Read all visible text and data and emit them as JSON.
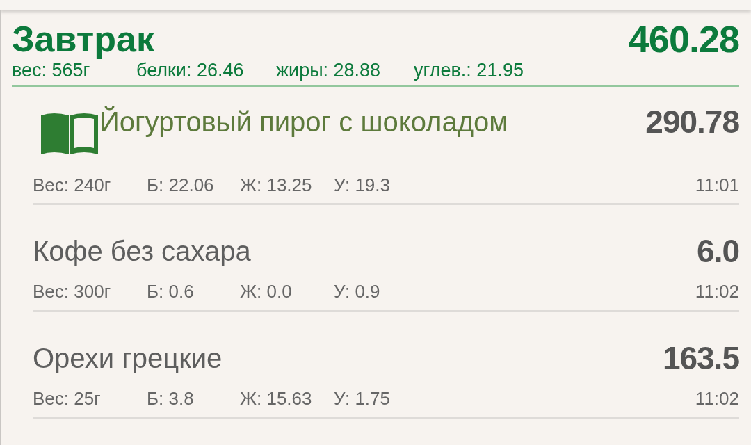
{
  "meal": {
    "title": "Завтрак",
    "calories": "460.28",
    "totals": [
      "вес: 565г",
      "белки: 26.46",
      "жиры: 28.88",
      "углев.: 21.95"
    ]
  },
  "items": [
    {
      "kind": "recipe",
      "name": "Йогуртовый пирог с шоколадом",
      "calories": "290.78",
      "details": [
        "Вес: 240г",
        "Б: 22.06",
        "Ж: 13.25",
        "У: 19.3"
      ],
      "time": "11:01"
    },
    {
      "kind": "product",
      "name": "Кофе без сахара",
      "calories": "6.0",
      "details": [
        "Вес: 300г",
        "Б: 0.6",
        "Ж: 0.0",
        "У: 0.9"
      ],
      "time": "11:02"
    },
    {
      "kind": "product",
      "name": "Орехи грецкие",
      "calories": "163.5",
      "details": [
        "Вес: 25г",
        "Б: 3.8",
        "Ж: 15.63",
        "У: 1.75"
      ],
      "time": "11:02"
    }
  ]
}
